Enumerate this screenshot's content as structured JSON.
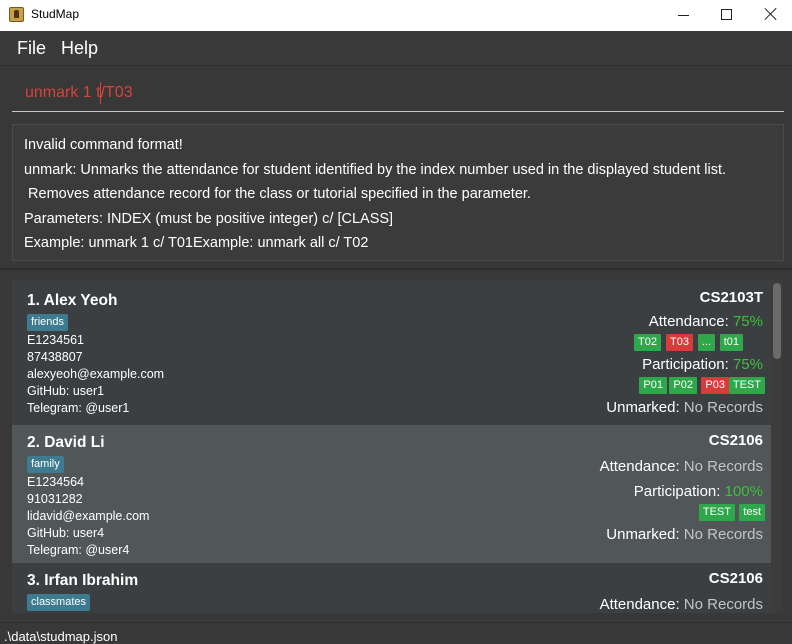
{
  "window": {
    "title": "StudMap"
  },
  "menu": {
    "file": "File",
    "help": "Help"
  },
  "command": {
    "value": "unmark 1 t/T03"
  },
  "result": {
    "lines": [
      "Invalid command format!",
      "unmark: Unmarks the attendance for student identified by the index number used in the displayed student list.",
      " Removes attendance record for the class or tutorial specified in the parameter.",
      "Parameters: INDEX (must be positive integer) c/ [CLASS]",
      "Example: unmark 1 c/ T01Example: unmark all c/ T02"
    ]
  },
  "labels": {
    "attendance": "Attendance:",
    "participation": "Participation:",
    "unmarked": "Unmarked:"
  },
  "students": [
    {
      "name": "1.  Alex Yeoh",
      "tag": "friends",
      "id": "E1234561",
      "phone": "87438807",
      "email": "alexyeoh@example.com",
      "github": "GitHub: user1",
      "telegram": "Telegram: @user1",
      "module": "CS2103T",
      "attendance": "75%",
      "attendance_badges": [
        {
          "label": "T02",
          "color": "#2ea84a"
        },
        {
          "label": "T03",
          "color": "#d83b3b"
        },
        {
          "label": "...",
          "color": "#2ea84a"
        },
        {
          "label": "t01",
          "color": "#2ea84a"
        }
      ],
      "participation": "75%",
      "participation_badges": [
        {
          "label": "P01",
          "color": "#2ea84a"
        },
        {
          "label": "P02",
          "color": "#2ea84a"
        },
        {
          "label": "P03",
          "color": "#d83b3b"
        },
        {
          "label": "TEST",
          "color": "#2ea84a"
        }
      ],
      "unmarked": "No Records"
    },
    {
      "name": "2.  David Li",
      "tag": "family",
      "id": "E1234564",
      "phone": "91031282",
      "email": "lidavid@example.com",
      "github": "GitHub: user4",
      "telegram": "Telegram: @user4",
      "module": "CS2106",
      "attendance": "No Records",
      "participation": "100%",
      "participation_badges": [
        {
          "label": "TEST",
          "color": "#2ea84a"
        },
        {
          "label": "test",
          "color": "#2ea84a"
        }
      ],
      "unmarked": "No Records"
    },
    {
      "name": "3.  Irfan Ibrahim",
      "tag": "classmates",
      "module": "CS2106",
      "attendance": "No Records"
    }
  ],
  "status": {
    "path": ".\\data\\studmap.json"
  }
}
